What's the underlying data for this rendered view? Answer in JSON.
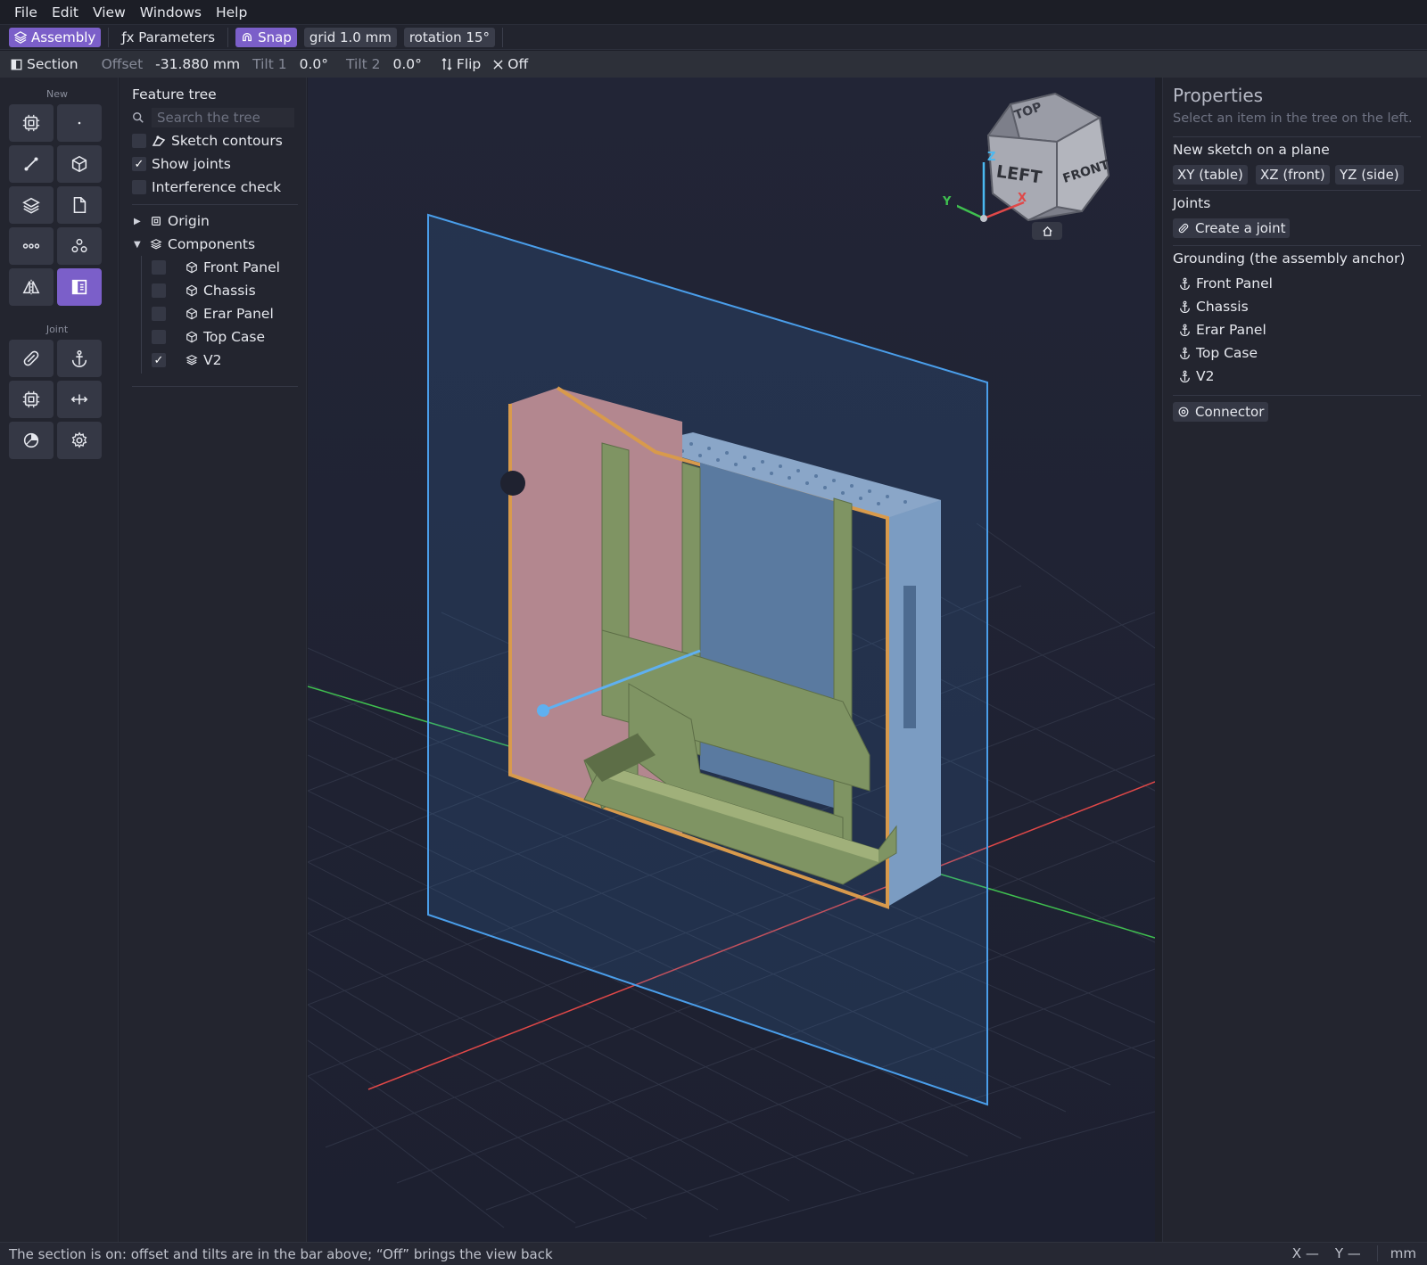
{
  "menu": [
    "File",
    "Edit",
    "View",
    "Windows",
    "Help"
  ],
  "toolbar": {
    "assembly": "Assembly",
    "parameters": "ƒx Parameters",
    "snap": "Snap",
    "grid": "grid 1.0 mm",
    "rotation": "rotation 15°"
  },
  "section": {
    "label": "Section",
    "offset_label": "Offset",
    "offset_value": "-31.880 mm",
    "tilt1_label": "Tilt 1",
    "tilt1_value": "0.0°",
    "tilt2_label": "Tilt 2",
    "tilt2_value": "0.0°",
    "flip": "Flip",
    "off": "Off"
  },
  "palette": {
    "new_label": "New",
    "joint_label": "Joint"
  },
  "tree": {
    "title": "Feature tree",
    "search_placeholder": "Search the tree",
    "options": [
      {
        "label": "Sketch contours",
        "checked": false
      },
      {
        "label": "Show joints",
        "checked": true
      },
      {
        "label": "Interference check",
        "checked": false
      }
    ],
    "origin": "Origin",
    "components": "Components",
    "items": [
      {
        "label": "Front Panel",
        "checked": false
      },
      {
        "label": "Chassis",
        "checked": false
      },
      {
        "label": "Erar Panel",
        "checked": false
      },
      {
        "label": "Top Case",
        "checked": false
      },
      {
        "label": "V2",
        "checked": true
      }
    ]
  },
  "viewcube": {
    "top": "TOP",
    "left": "LEFT",
    "front": "FRONT",
    "axis_x": "X",
    "axis_y": "Y",
    "axis_z": "Z"
  },
  "properties": {
    "title": "Properties",
    "subtitle": "Select an item in the tree on the left.",
    "sketch_heading": "New sketch on a plane",
    "planes": [
      "XY (table)",
      "XZ (front)",
      "YZ (side)"
    ],
    "joints_heading": "Joints",
    "create_joint": "Create a joint",
    "grounding_heading": "Grounding (the assembly anchor)",
    "grounding_items": [
      "Front Panel",
      "Chassis",
      "Erar Panel",
      "Top Case",
      "V2"
    ],
    "connector": "Connector"
  },
  "status": {
    "message": "The section is on: offset and tilts are in the bar above; “Off” brings the view back",
    "x": "X —",
    "y": "Y —",
    "unit": "mm"
  },
  "colors": {
    "accent": "#7b5fc9",
    "section_plane": "#4a9eea",
    "axis_x": "#e04848",
    "axis_y": "#3fbf4f",
    "axis_z": "#4ab8f0"
  }
}
